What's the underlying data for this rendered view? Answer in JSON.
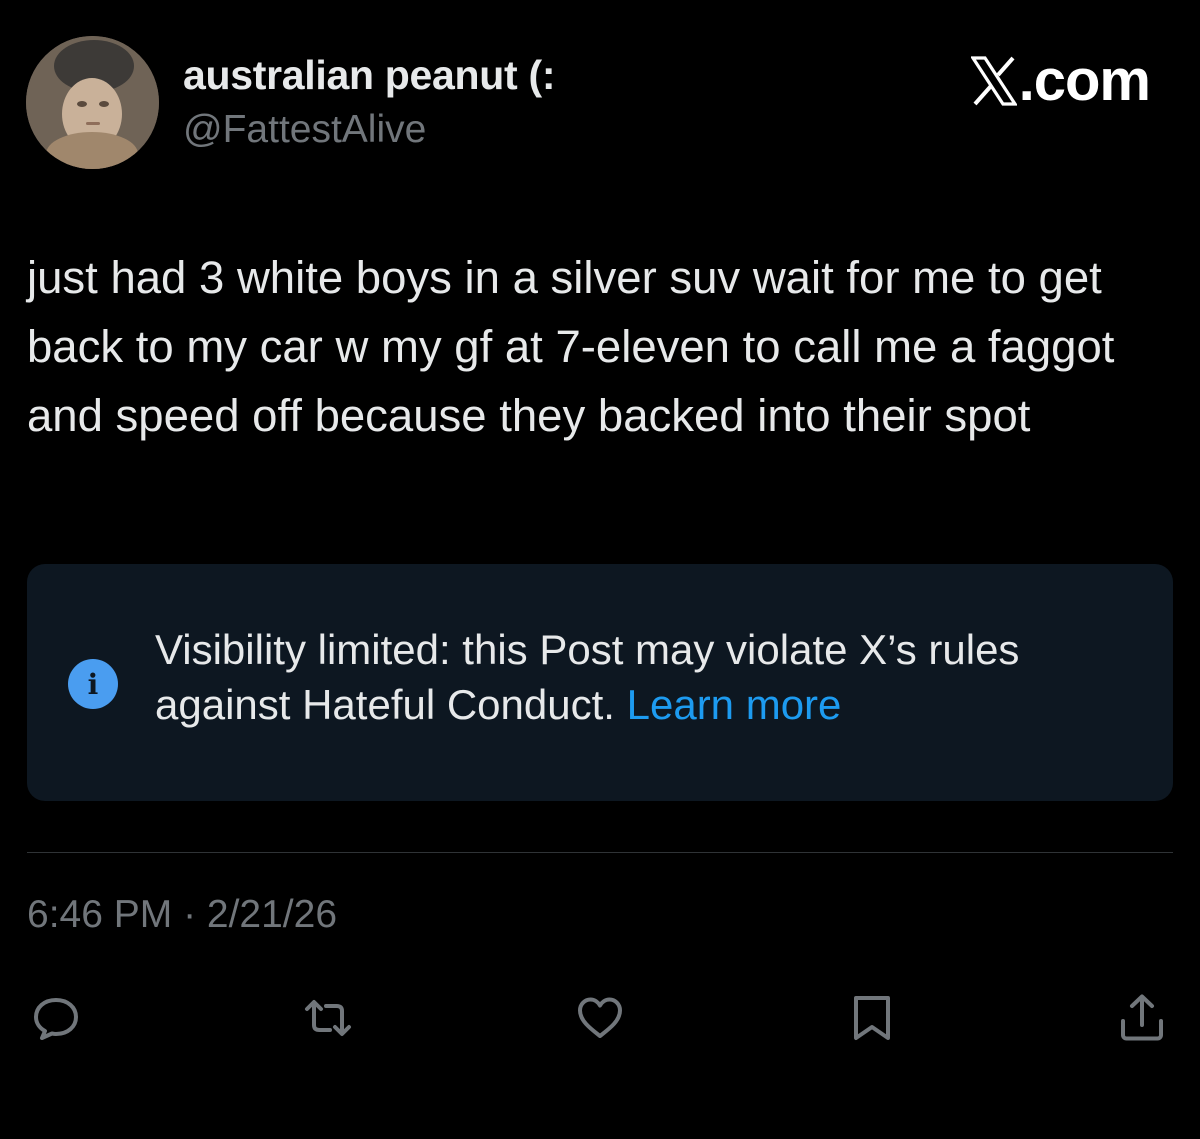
{
  "author": {
    "display_name": "australian peanut (:",
    "handle": "@FattestAlive"
  },
  "brand": {
    "text": ".com",
    "logo_icon": "x-logo-icon"
  },
  "post": {
    "text": "just had 3 white boys in a silver suv wait for me to get back to my car w my gf at 7-eleven to call me a faggot and speed off because they backed into their spot"
  },
  "notice": {
    "icon": "info-icon",
    "icon_glyph": "i",
    "message": "Visibility limited: this Post may violate X’s rules against Hateful Conduct. ",
    "link_label": "Learn more"
  },
  "meta": {
    "timestamp": "6:46 PM · 2/21/26"
  },
  "actions": [
    {
      "name": "reply",
      "icon": "reply-icon"
    },
    {
      "name": "repost",
      "icon": "repost-icon"
    },
    {
      "name": "like",
      "icon": "heart-icon"
    },
    {
      "name": "bookmark",
      "icon": "bookmark-icon"
    },
    {
      "name": "share",
      "icon": "share-icon"
    }
  ],
  "colors": {
    "background": "#000000",
    "text_primary": "#e7e9ea",
    "text_secondary": "#71767b",
    "link": "#1d9bf0",
    "notice_bg": "#0d1721",
    "info_icon": "#4a9df0"
  }
}
